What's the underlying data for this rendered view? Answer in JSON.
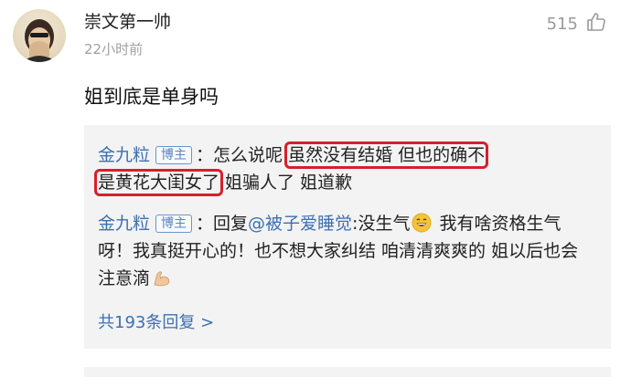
{
  "comment": {
    "username": "崇文第一帅",
    "timestamp": "22小时前",
    "like_count": "515",
    "text": "姐到底是单身吗"
  },
  "replies": [
    {
      "author": "金九粒",
      "badge": "博主",
      "prefix": "：怎么说呢 ",
      "highlight1": "虽然没有结婚 但也的确不",
      "highlight2": "是黄花大闺女了",
      "suffix": " 姐骗人了 姐道歉"
    },
    {
      "author": "金九粒",
      "badge": "博主",
      "prefix": "：回复",
      "mention": "@被子爱睡觉",
      "text1": ":没生气",
      "text2": " 我有啥资格生气呀！我真挺开心的！也不想大家纠结 咱清清爽爽的 姐以后也会注意滴"
    }
  ],
  "more_replies": "共193条回复 >",
  "colors": {
    "link": "#3d6fb0",
    "highlight_box": "#d6202c",
    "reply_bg": "#f3f3f3"
  },
  "icons": [
    "avatar",
    "thumbs-up-icon",
    "grinning-emoji-icon",
    "flexed-biceps-emoji-icon"
  ]
}
